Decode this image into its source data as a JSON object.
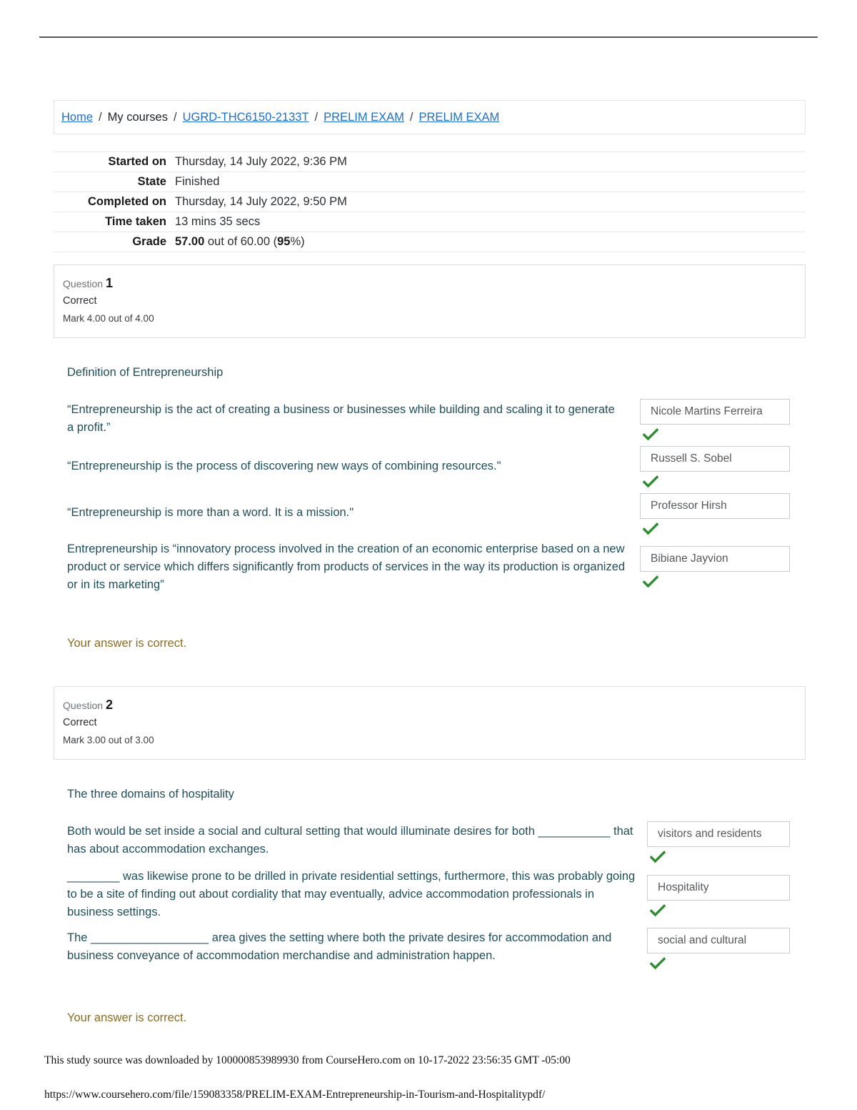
{
  "breadcrumb": {
    "items": [
      {
        "label": "Home",
        "link": true
      },
      {
        "label": "My courses",
        "link": false
      },
      {
        "label": "UGRD-THC6150-2133T",
        "link": true
      },
      {
        "label": "PRELIM EXAM",
        "link": true
      },
      {
        "label": "PRELIM EXAM",
        "link": true
      }
    ],
    "separator": "/"
  },
  "summary": {
    "rows": [
      {
        "label": "Started on",
        "value": "Thursday, 14 July 2022, 9:36 PM"
      },
      {
        "label": "State",
        "value": "Finished"
      },
      {
        "label": "Completed on",
        "value": "Thursday, 14 July 2022, 9:50 PM"
      },
      {
        "label": "Time taken",
        "value": "13 mins 35 secs"
      }
    ],
    "grade": {
      "label": "Grade",
      "score": "57.00",
      "middle": " out of 60.00 (",
      "percent": "95",
      "tail": "%)"
    }
  },
  "questions": [
    {
      "number_label": "Question",
      "number": "1",
      "state": "Correct",
      "mark": "Mark 4.00 out of 4.00",
      "title": "Definition of Entrepreneurship",
      "statements": [
        "“Entrepreneurship is the act of creating a business or businesses while building and scaling it to generate a profit.”",
        "“Entrepreneurship is the process of discovering new ways of combining resources.\"",
        "“Entrepreneurship is more than a word. It is a mission.\"",
        "Entrepreneurship is “innovatory process involved in the creation of an economic enterprise based on a new product or service which differs significantly from products of services in the way its production is organized or in its marketing”"
      ],
      "answers": [
        "Nicole Martins Ferreira",
        "Russell S. Sobel",
        "Professor Hirsh",
        "Bibiane Jayvion"
      ],
      "feedback": "Your answer is correct."
    },
    {
      "number_label": "Question",
      "number": "2",
      "state": "Correct",
      "mark": "Mark 3.00 out of 3.00",
      "title": "The three domains of hospitality",
      "statements": [
        "Both would be set inside a social and cultural setting that would illuminate desires for both ___________ that has about accommodation exchanges.",
        "________ was likewise prone to be drilled in private residential settings, furthermore, this was probably going to be a site of finding out about cordiality that may eventually, advice accommodation professionals in business settings.",
        "The __________________ area gives the setting where both the private desires for accommodation and business conveyance of accommodation merchandise and administration happen."
      ],
      "answers": [
        "visitors and residents",
        "Hospitality",
        "social and cultural"
      ],
      "feedback": "Your answer is correct."
    }
  ],
  "footer": {
    "download_notice": "This study source was downloaded by 100000853989930 from CourseHero.com on 10-17-2022 23:56:35 GMT -05:00",
    "source_url": "https://www.coursehero.com/file/159083358/PRELIM-EXAM-Entrepreneurship-in-Tourism-and-Hospitalitypdf/"
  },
  "colors": {
    "link": "#1d6fc9",
    "question_text": "#1f4e5a",
    "feedback": "#8a6d25",
    "check": "#2e8b2e"
  }
}
